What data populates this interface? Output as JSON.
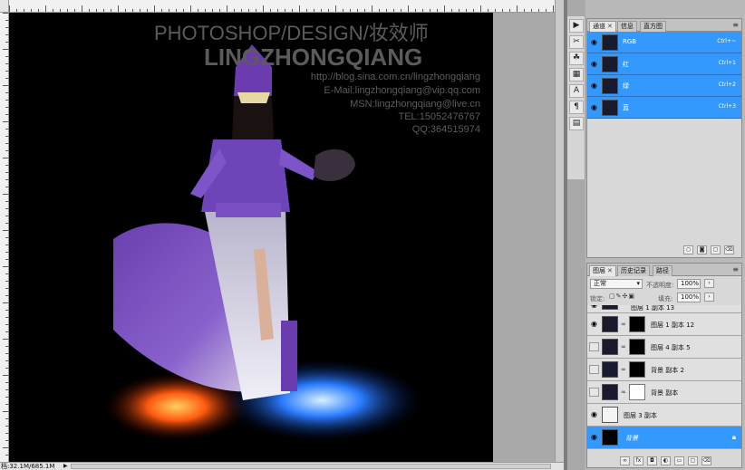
{
  "status_bar": {
    "doc_size": "档:32.1M/685.1M",
    "arrow": "▶"
  },
  "artwork": {
    "heading": "PHOTOSHOP/DESIGN/妆效师",
    "name": "LINGZHONGQIANG",
    "blog": "http://blog.sina.com.cn/lingzhongqiang",
    "email": "E-Mail:lingzhongqiang@vip.qq.com",
    "msn": "MSN:lingzhongqiang@live.cn",
    "tel": "TEL:15052476767",
    "qq": "QQ:364515974"
  },
  "channels_panel": {
    "tabs": [
      {
        "label": "通道",
        "active": true
      },
      {
        "label": "信息",
        "active": false
      },
      {
        "label": "直方图",
        "active": false
      }
    ],
    "channels": [
      {
        "name": "RGB",
        "shortcut": "Ctrl+~"
      },
      {
        "name": "红",
        "shortcut": "Ctrl+1"
      },
      {
        "name": "绿",
        "shortcut": "Ctrl+2"
      },
      {
        "name": "蓝",
        "shortcut": "Ctrl+3"
      }
    ]
  },
  "layers_panel": {
    "tabs": [
      {
        "label": "图层",
        "active": true
      },
      {
        "label": "历史记录",
        "active": false
      },
      {
        "label": "路径",
        "active": false
      }
    ],
    "blend_mode": "正常",
    "opacity_label": "不透明度:",
    "opacity_value": "100%",
    "lock_label": "锁定:",
    "fill_label": "填充:",
    "fill_value": "100%",
    "layers": [
      {
        "name": "图层 1 副本 13",
        "visible": true,
        "has_mask": true,
        "selected": false
      },
      {
        "name": "图层 1 副本 12",
        "visible": true,
        "has_mask": true,
        "selected": false
      },
      {
        "name": "图层 4 副本 5",
        "visible": false,
        "has_mask": true,
        "selected": false
      },
      {
        "name": "背景 副本 2",
        "visible": false,
        "has_mask": true,
        "selected": false
      },
      {
        "name": "背景 副本",
        "visible": false,
        "has_mask": true,
        "selected": false
      },
      {
        "name": "图层 3 副本",
        "visible": true,
        "has_mask": false,
        "selected": false
      },
      {
        "name": "背景",
        "visible": true,
        "has_mask": false,
        "selected": true
      }
    ],
    "footer_icons": [
      "link-icon",
      "fx-icon",
      "mask-icon",
      "adjustment-icon",
      "group-icon",
      "new-layer-icon",
      "trash-icon"
    ]
  },
  "colors": {
    "selection": "#3399ff",
    "panel_bg": "#d8d8d8",
    "canvas_bg": "#000000"
  }
}
